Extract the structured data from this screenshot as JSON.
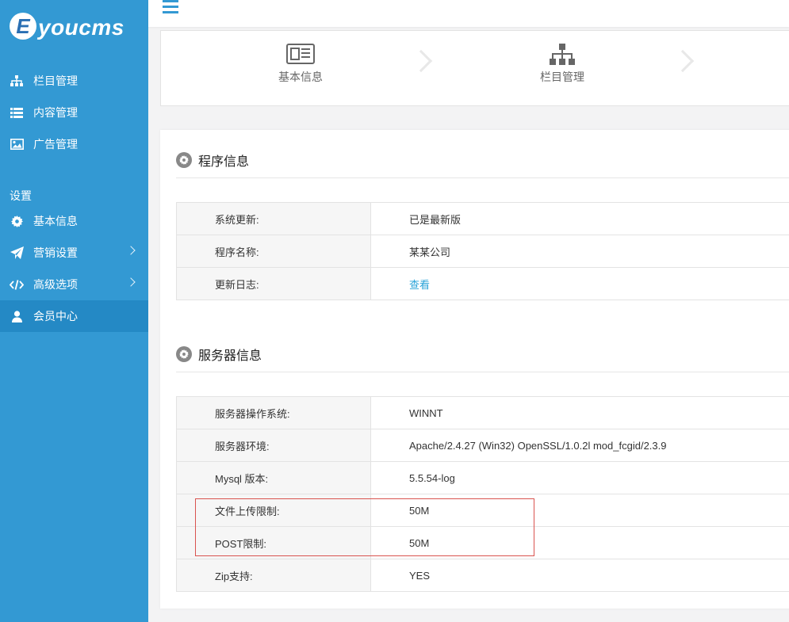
{
  "logo": {
    "letter": "E",
    "text": "youcms"
  },
  "sidebar": {
    "items": [
      {
        "label": "栏目管理",
        "icon": "sitemap-icon"
      },
      {
        "label": "内容管理",
        "icon": "list-icon"
      },
      {
        "label": "广告管理",
        "icon": "image-icon"
      }
    ],
    "section_label": "设置",
    "settings": [
      {
        "label": "基本信息",
        "icon": "gear-icon"
      },
      {
        "label": "营销设置",
        "icon": "paper-plane-icon"
      },
      {
        "label": "高级选项",
        "icon": "code-icon"
      },
      {
        "label": "会员中心",
        "icon": "user-icon"
      }
    ]
  },
  "steps": [
    {
      "label": "基本信息",
      "icon": "newspaper-icon"
    },
    {
      "label": "栏目管理",
      "icon": "sitemap-icon"
    }
  ],
  "program": {
    "title": "程序信息",
    "rows": [
      {
        "key": "系统更新:",
        "value": "已是最新版"
      },
      {
        "key": "程序名称:",
        "value": "某某公司"
      },
      {
        "key": "更新日志:",
        "value": "查看"
      }
    ]
  },
  "server": {
    "title": "服务器信息",
    "rows": [
      {
        "key": "服务器操作系统:",
        "value": "WINNT"
      },
      {
        "key": "服务器环境:",
        "value": "Apache/2.4.27 (Win32) OpenSSL/1.0.2l mod_fcgid/2.3.9"
      },
      {
        "key": "Mysql 版本:",
        "value": "5.5.54-log"
      },
      {
        "key": "文件上传限制:",
        "value": "50M"
      },
      {
        "key": "POST限制:",
        "value": "50M"
      },
      {
        "key": "Zip支持:",
        "value": "YES"
      }
    ]
  },
  "colors": {
    "sidebar": "#3399d3",
    "active": "#2489c5",
    "link": "#2aa3d8",
    "highlight": "#d9534f"
  }
}
